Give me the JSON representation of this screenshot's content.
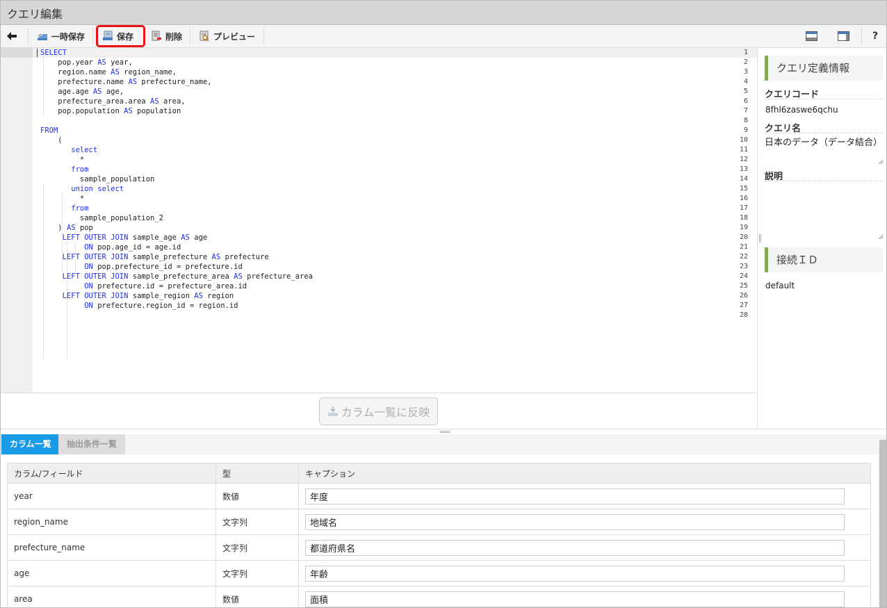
{
  "window": {
    "title": "クエリ編集"
  },
  "toolbar": {
    "temp_save_label": "一時保存",
    "save_label": "保存",
    "delete_label": "削除",
    "preview_label": "プレビュー",
    "help_label": "?"
  },
  "editor": {
    "line_numbers": [
      "1",
      "2",
      "3",
      "4",
      "5",
      "6",
      "7",
      "8",
      "9",
      "10",
      "11",
      "12",
      "13",
      "14",
      "15",
      "16",
      "17",
      "18",
      "19",
      "20",
      "21",
      "22",
      "23",
      "24",
      "25",
      "26",
      "27",
      "28"
    ],
    "lines": [
      [
        {
          "t": "SELECT",
          "k": true
        }
      ],
      [
        {
          "t": "    pop.year "
        },
        {
          "t": "AS",
          "k": true
        },
        {
          "t": " year,"
        }
      ],
      [
        {
          "t": "    region.name "
        },
        {
          "t": "AS",
          "k": true
        },
        {
          "t": " region_name,"
        }
      ],
      [
        {
          "t": "    prefecture.name "
        },
        {
          "t": "AS",
          "k": true
        },
        {
          "t": " prefecture_name,"
        }
      ],
      [
        {
          "t": "    age.age "
        },
        {
          "t": "AS",
          "k": true
        },
        {
          "t": " age,"
        }
      ],
      [
        {
          "t": "    prefecture_area.area "
        },
        {
          "t": "AS",
          "k": true
        },
        {
          "t": " area,"
        }
      ],
      [
        {
          "t": "    pop.population "
        },
        {
          "t": "AS",
          "k": true
        },
        {
          "t": " population"
        }
      ],
      [],
      [
        {
          "t": "FROM",
          "k": true
        }
      ],
      [
        {
          "t": "    ("
        }
      ],
      [
        {
          "t": "       "
        },
        {
          "t": "select",
          "k": true
        }
      ],
      [
        {
          "t": "         *"
        }
      ],
      [
        {
          "t": "       "
        },
        {
          "t": "from",
          "k": true
        }
      ],
      [
        {
          "t": "         sample_population"
        }
      ],
      [
        {
          "t": "       "
        },
        {
          "t": "union select",
          "k": true
        }
      ],
      [
        {
          "t": "         *"
        }
      ],
      [
        {
          "t": "       "
        },
        {
          "t": "from",
          "k": true
        }
      ],
      [
        {
          "t": "         sample_population_2"
        }
      ],
      [
        {
          "t": "    ) "
        },
        {
          "t": "AS",
          "k": true
        },
        {
          "t": " pop"
        }
      ],
      [
        {
          "t": "     "
        },
        {
          "t": "LEFT OUTER JOIN",
          "k": true
        },
        {
          "t": " sample_age "
        },
        {
          "t": "AS",
          "k": true
        },
        {
          "t": " age"
        }
      ],
      [
        {
          "t": "          "
        },
        {
          "t": "ON",
          "k": true
        },
        {
          "t": " pop.age_id = age.id"
        }
      ],
      [
        {
          "t": "     "
        },
        {
          "t": "LEFT OUTER JOIN",
          "k": true
        },
        {
          "t": " sample_prefecture "
        },
        {
          "t": "AS",
          "k": true
        },
        {
          "t": " prefecture"
        }
      ],
      [
        {
          "t": "          "
        },
        {
          "t": "ON",
          "k": true
        },
        {
          "t": " pop.prefecture_id = prefecture.id"
        }
      ],
      [
        {
          "t": "     "
        },
        {
          "t": "LEFT OUTER JOIN",
          "k": true
        },
        {
          "t": " sample_prefecture_area "
        },
        {
          "t": "AS",
          "k": true
        },
        {
          "t": " prefecture_area"
        }
      ],
      [
        {
          "t": "          "
        },
        {
          "t": "ON",
          "k": true
        },
        {
          "t": " prefecture.id = prefecture_area.id"
        }
      ],
      [
        {
          "t": "     "
        },
        {
          "t": "LEFT OUTER JOIN",
          "k": true
        },
        {
          "t": " sample_region "
        },
        {
          "t": "AS",
          "k": true
        },
        {
          "t": " region"
        }
      ],
      [
        {
          "t": "          "
        },
        {
          "t": "ON",
          "k": true
        },
        {
          "t": " prefecture.region_id = region.id"
        }
      ],
      []
    ],
    "reflect_button_label": "カラム一覧に反映"
  },
  "sidebar": {
    "section1_title": "クエリ定義情報",
    "query_code_label": "クエリコード",
    "query_code_value": "8fhl6zaswe6qchu",
    "query_name_label": "クエリ名",
    "query_name_value": "日本のデータ（データ結合）",
    "description_label": "説明",
    "description_value": "",
    "section2_title": "接続ＩＤ",
    "connection_value": "default"
  },
  "bottom": {
    "tabs": [
      "カラム一覧",
      "抽出条件一覧"
    ],
    "headers": [
      "カラム/フィールド",
      "型",
      "キャプション"
    ],
    "rows": [
      {
        "field": "year",
        "type": "数値",
        "caption": "年度"
      },
      {
        "field": "region_name",
        "type": "文字列",
        "caption": "地域名"
      },
      {
        "field": "prefecture_name",
        "type": "文字列",
        "caption": "都道府県名"
      },
      {
        "field": "age",
        "type": "文字列",
        "caption": "年齢"
      },
      {
        "field": "area",
        "type": "数値",
        "caption": "面積"
      }
    ]
  },
  "colors": {
    "keyword": "#1e2ff0",
    "active_tab": "#1a9be8",
    "highlight": "#e8141a",
    "accent": "#8aa85a"
  }
}
